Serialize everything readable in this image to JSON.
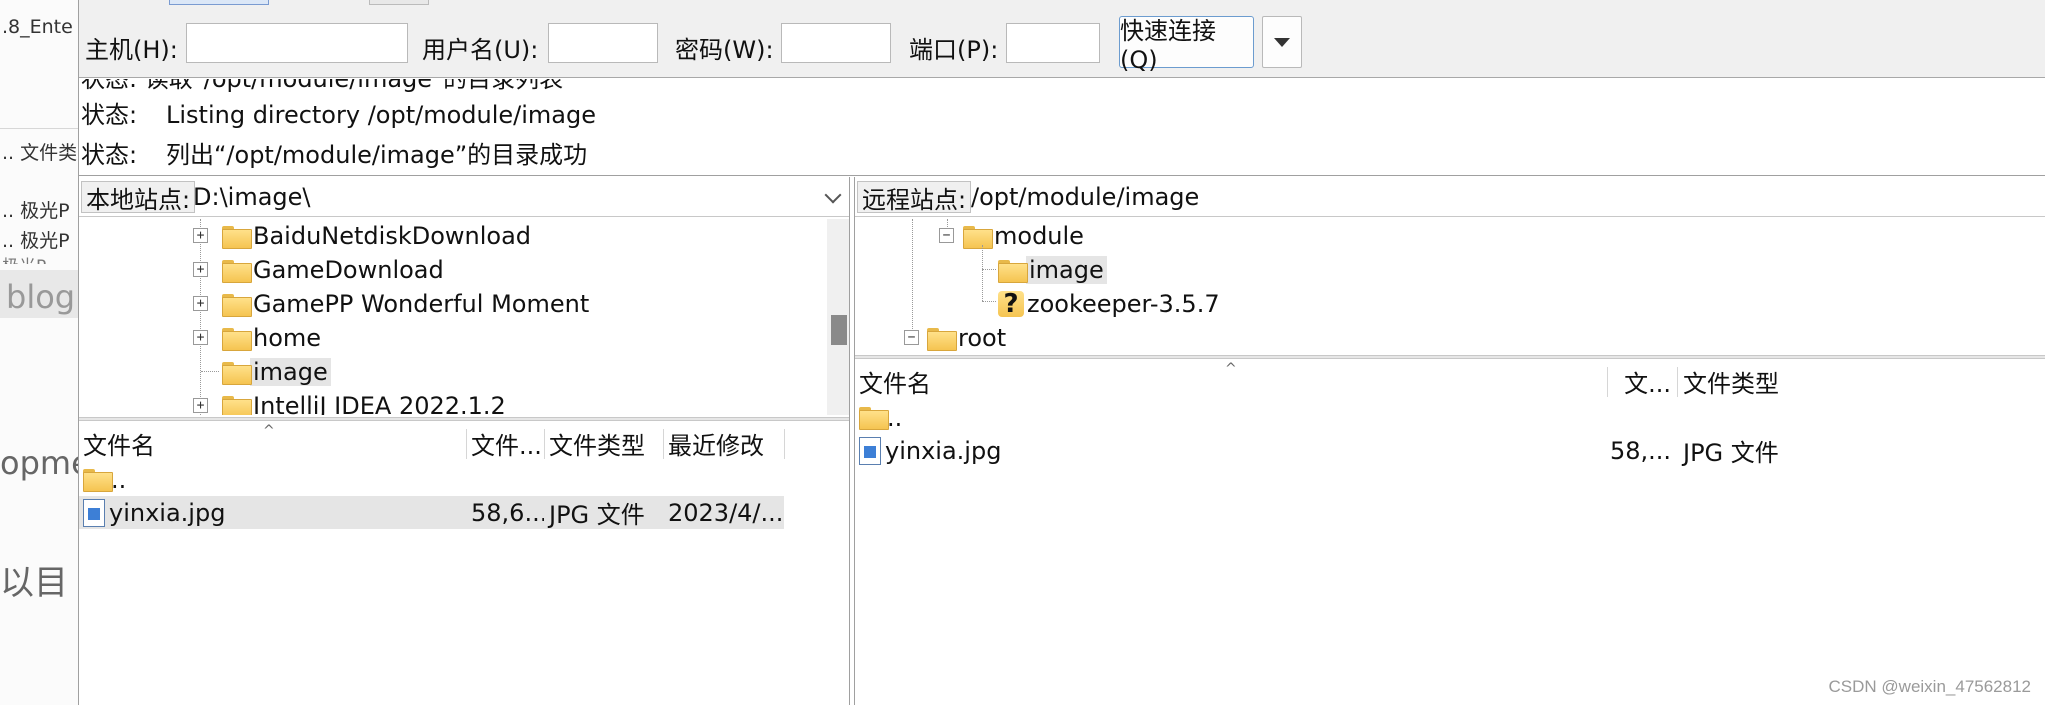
{
  "background": {
    "title_fragment": ".8_Ente",
    "snippet_1": ".. 文件类",
    "snippet_2": ".. 极光P",
    "snippet_3": ".. 极光P",
    "snippet_4": "极光P",
    "blog_text": "blog",
    "snippet_5": "opme",
    "snippet_6": "以目"
  },
  "quickconnect": {
    "host_label": "主机(H):",
    "host_value": "",
    "user_label": "用户名(U):",
    "user_value": "",
    "password_label": "密码(W):",
    "password_value": "",
    "port_label": "端口(P):",
    "port_value": "",
    "connect_button": "快速连接(Q)"
  },
  "status_log": {
    "partial_line": "状态:    读取\"/opt/module/image\"的目录列表",
    "lines": [
      {
        "label": "状态:",
        "text": "Listing directory /opt/module/image"
      },
      {
        "label": "状态:",
        "text": "列出“/opt/module/image”的目录成功"
      }
    ]
  },
  "local": {
    "site_label": "本地站点:",
    "path": "D:\\image\\",
    "tree": [
      {
        "name": "BaiduNetdiskDownload",
        "expandable": true,
        "selected": false
      },
      {
        "name": "GameDownload",
        "expandable": true,
        "selected": false
      },
      {
        "name": "GamePP Wonderful Moment",
        "expandable": true,
        "selected": false
      },
      {
        "name": "home",
        "expandable": true,
        "selected": false
      },
      {
        "name": "image",
        "expandable": false,
        "selected": true
      },
      {
        "name": "IntelliJ IDEA 2022.1.2",
        "expandable": true,
        "selected": false
      }
    ],
    "columns": [
      "文件名",
      "文件...",
      "文件类型",
      "最近修改"
    ],
    "files": [
      {
        "name": "..",
        "size": "",
        "type": "",
        "modified": "",
        "icon": "folder-icon"
      },
      {
        "name": "yinxia.jpg",
        "size": "58,6...",
        "type": "JPG 文件",
        "modified": "2023/4/...",
        "icon": "jpg-file-icon"
      }
    ]
  },
  "remote": {
    "site_label": "远程站点:",
    "path": "/opt/module/image",
    "tree": [
      {
        "name": "module",
        "level": 1,
        "expanded": true,
        "selected": false,
        "icon": "folder-icon"
      },
      {
        "name": "image",
        "level": 2,
        "expanded": false,
        "selected": true,
        "icon": "folder-icon"
      },
      {
        "name": "zookeeper-3.5.7",
        "level": 2,
        "expanded": false,
        "selected": false,
        "icon": "unknown-folder-icon"
      },
      {
        "name": "root",
        "level": 0,
        "expanded": true,
        "selected": false,
        "icon": "folder-icon"
      }
    ],
    "columns": [
      "文件名",
      "文...",
      "文件类型"
    ],
    "files": [
      {
        "name": "..",
        "size": "",
        "type": "",
        "icon": "folder-icon"
      },
      {
        "name": "yinxia.jpg",
        "size": "58,...",
        "type": "JPG 文件",
        "icon": "jpg-file-icon"
      }
    ]
  },
  "watermark": "CSDN @weixin_47562812"
}
